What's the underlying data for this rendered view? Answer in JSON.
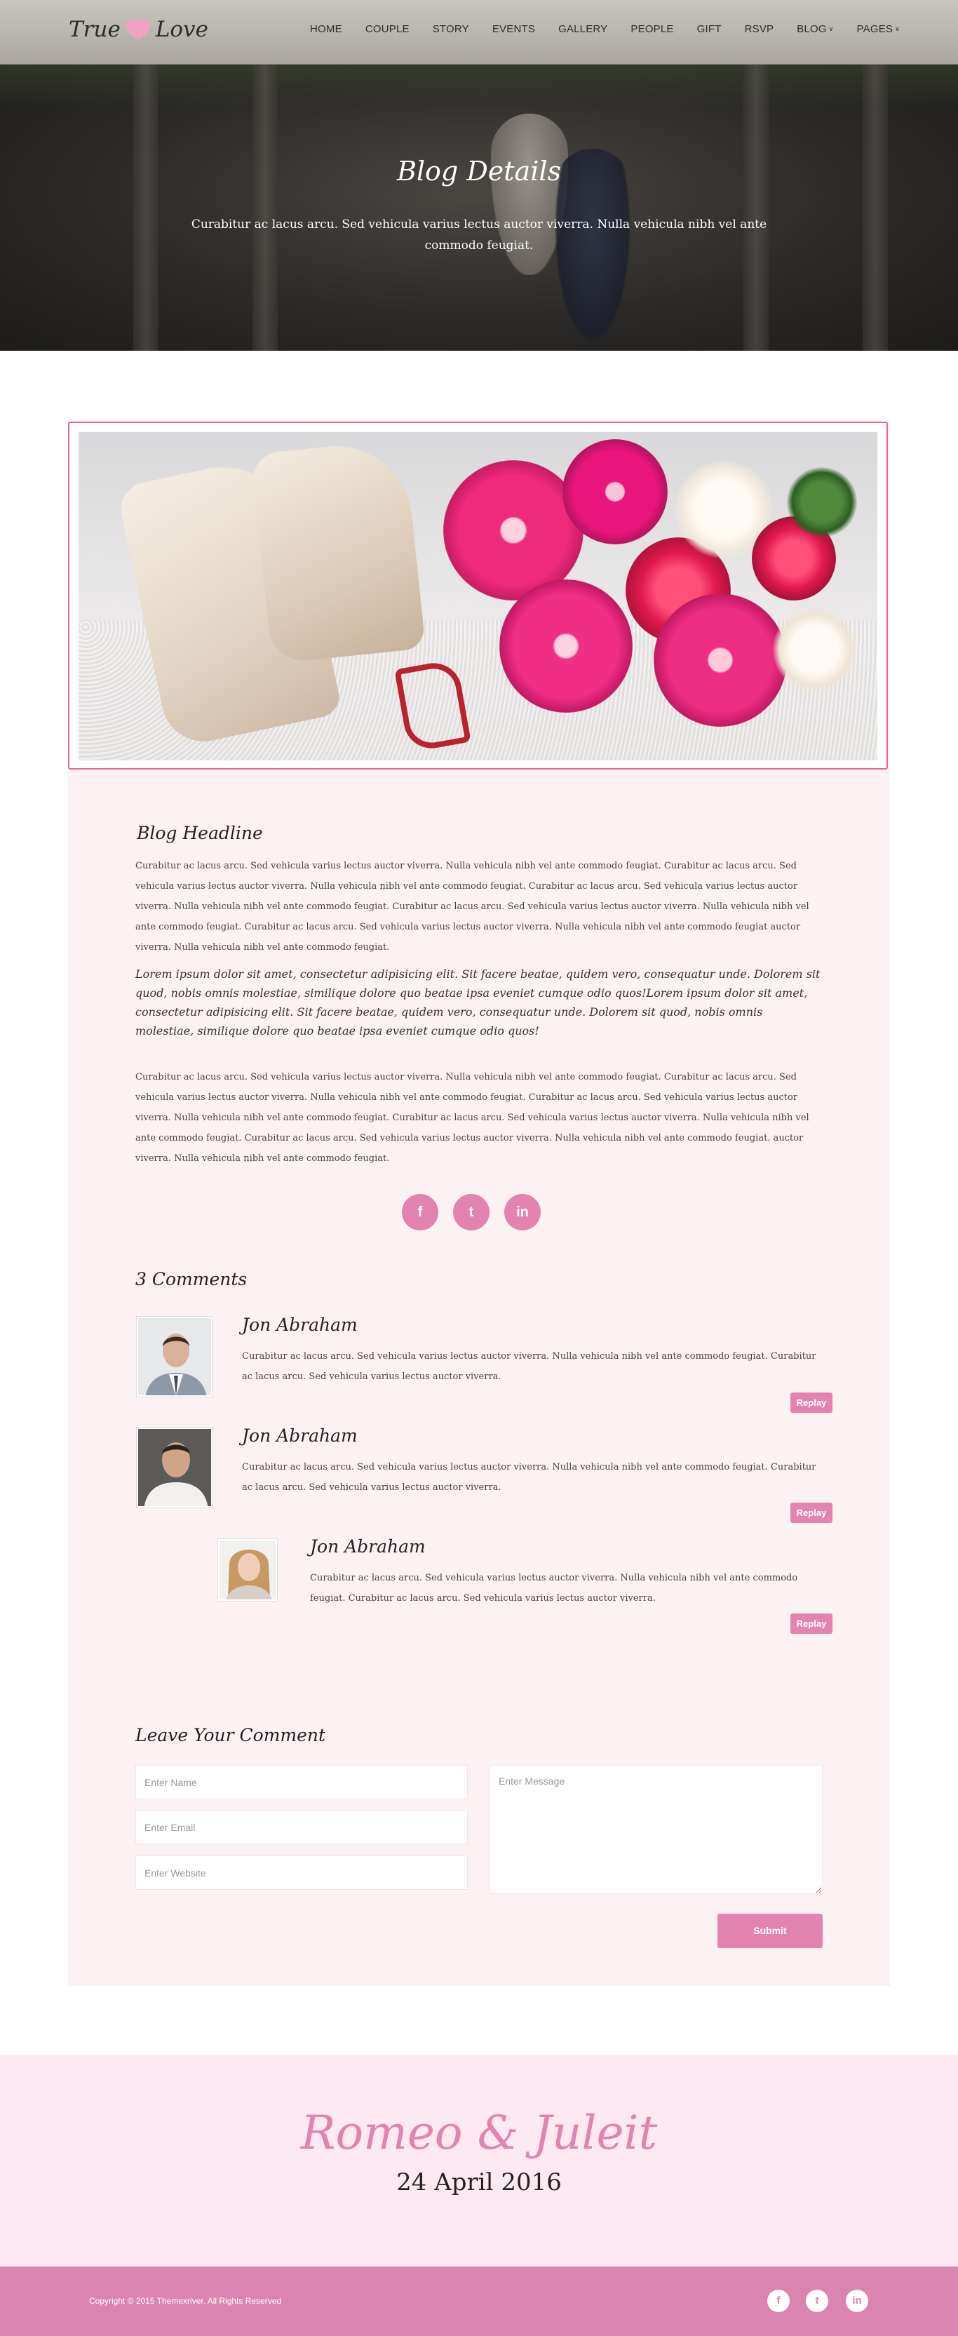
{
  "brand": {
    "name_left": "True",
    "name_right": "Love",
    "heart_icon": "heart-icon"
  },
  "nav": {
    "items": [
      {
        "label": "HOME"
      },
      {
        "label": "COUPLE"
      },
      {
        "label": "STORY"
      },
      {
        "label": "EVENTS"
      },
      {
        "label": "GALLERY"
      },
      {
        "label": "PEOPLE"
      },
      {
        "label": "GIFT"
      },
      {
        "label": "RSVP"
      },
      {
        "label": "BLOG",
        "dropdown": true
      },
      {
        "label": "PAGES",
        "dropdown": true
      }
    ]
  },
  "hero": {
    "title": "Blog Details",
    "subtitle": "Curabitur ac lacus arcu. Sed vehicula varius lectus auctor viverra. Nulla vehicula nibh vel ante commodo feugiat."
  },
  "post": {
    "headline": "Blog Headline",
    "paragraph1": "Curabitur ac lacus arcu. Sed vehicula varius lectus auctor viverra. Nulla vehicula nibh vel ante commodo feugiat. Curabitur ac lacus arcu. Sed vehicula varius lectus auctor viverra. Nulla vehicula nibh vel ante commodo feugiat. Curabitur ac lacus arcu. Sed vehicula varius lectus auctor viverra. Nulla vehicula nibh vel ante commodo feugiat. Curabitur ac lacus arcu. Sed vehicula varius lectus auctor viverra. Nulla vehicula nibh vel ante commodo feugiat. Curabitur ac lacus arcu. Sed vehicula varius lectus auctor viverra. Nulla vehicula nibh vel ante commodo feugiat auctor viverra. Nulla vehicula nibh vel ante commodo feugiat.",
    "quote": "Lorem ipsum dolor sit amet, consectetur adipisicing elit. Sit facere beatae, quidem vero, consequatur unde. Dolorem sit quod, nobis omnis molestiae, similique dolore quo beatae ipsa eveniet cumque odio quos!Lorem ipsum dolor sit amet, consectetur adipisicing elit. Sit facere beatae, quidem vero, consequatur unde. Dolorem sit quod, nobis omnis molestiae, similique dolore quo beatae ipsa eveniet cumque odio quos!",
    "paragraph2": "Curabitur ac lacus arcu. Sed vehicula varius lectus auctor viverra. Nulla vehicula nibh vel ante commodo feugiat. Curabitur ac lacus arcu. Sed vehicula varius lectus auctor viverra. Nulla vehicula nibh vel ante commodo feugiat. Curabitur ac lacus arcu. Sed vehicula varius lectus auctor viverra. Nulla vehicula nibh vel ante commodo feugiat. Curabitur ac lacus arcu. Sed vehicula varius lectus auctor viverra. Nulla vehicula nibh vel ante commodo feugiat. Curabitur ac lacus arcu. Sed vehicula varius lectus auctor viverra. Nulla vehicula nibh vel ante commodo feugiat. auctor viverra. Nulla vehicula nibh vel ante commodo feugiat.",
    "share": [
      {
        "icon": "facebook-icon",
        "glyph": "f"
      },
      {
        "icon": "twitter-icon",
        "glyph": "t"
      },
      {
        "icon": "linkedin-icon",
        "glyph": "in"
      }
    ]
  },
  "comments": {
    "title": "3 Comments",
    "reply_label": "Replay",
    "items": [
      {
        "name": "Jon Abraham",
        "text": "Curabitur ac lacus arcu. Sed vehicula varius lectus auctor viverra. Nulla vehicula nibh vel ante commodo feugiat. Curabitur ac lacus arcu. Sed vehicula varius lectus auctor viverra."
      },
      {
        "name": "Jon Abraham",
        "text": "Curabitur ac lacus arcu. Sed vehicula varius lectus auctor viverra. Nulla vehicula nibh vel ante commodo feugiat. Curabitur ac lacus arcu. Sed vehicula varius lectus auctor viverra."
      },
      {
        "name": "Jon Abraham",
        "text": "Curabitur ac lacus arcu. Sed vehicula varius lectus auctor viverra. Nulla vehicula nibh vel ante commodo feugiat. Curabitur ac lacus arcu. Sed vehicula varius lectus auctor viverra."
      }
    ]
  },
  "form": {
    "title": "Leave Your Comment",
    "name_placeholder": "Enter Name",
    "email_placeholder": "Enter Email",
    "website_placeholder": "Enter Website",
    "message_placeholder": "Enter Message",
    "submit_label": "Submit"
  },
  "couple": {
    "names": "Romeo & Juleit",
    "date": "24 April 2016"
  },
  "footer": {
    "copyright": "Copyright © 2015 Themexriver. All Rights Reserved",
    "social": [
      {
        "icon": "facebook-icon",
        "glyph": "f"
      },
      {
        "icon": "twitter-icon",
        "glyph": "t"
      },
      {
        "icon": "linkedin-icon",
        "glyph": "in"
      }
    ]
  },
  "colors": {
    "accent": "#e283b0",
    "footer": "#d985b0",
    "content_bg": "#fdf2f3",
    "band_bg": "#fde9f2",
    "frame": "#e5669b"
  }
}
